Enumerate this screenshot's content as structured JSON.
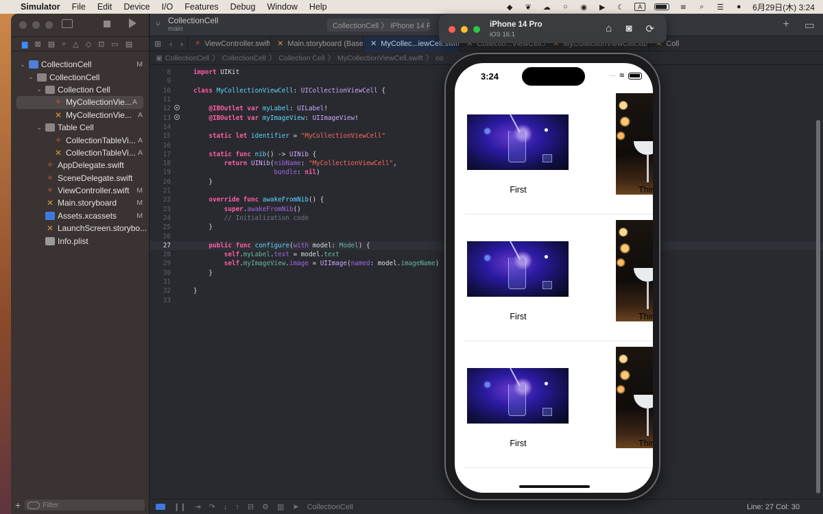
{
  "menubar": {
    "app": "Simulator",
    "items": [
      "File",
      "Edit",
      "Device",
      "I/O",
      "Features",
      "Debug",
      "Window",
      "Help"
    ],
    "input_indicator": "A",
    "datetime": "6月29日(木)  3:24"
  },
  "xcode": {
    "project_title": "CollectionCell",
    "branch": "main",
    "destination": "CollectionCell 〉 iPhone 14 P",
    "tabs": [
      "ViewController.swift",
      "Main.storyboard (Base)",
      "MyCollec...iewCell.swift",
      "Collectio...ViewCell.xib",
      "MyCollectionViewCell.xib",
      "Coll"
    ],
    "jumpbar": [
      "CollectionCell",
      "CollectionCell",
      "Collection Cell",
      "MyCollectionViewCell.swift",
      "co"
    ],
    "navigator": [
      {
        "label": "CollectionCell",
        "badge": "M",
        "level": 0,
        "icon": "project",
        "chevron": "v"
      },
      {
        "label": "CollectionCell",
        "badge": "",
        "level": 1,
        "icon": "folder",
        "chevron": "v"
      },
      {
        "label": "Collection Cell",
        "badge": "",
        "level": 2,
        "icon": "folder",
        "chevron": "v"
      },
      {
        "label": "MyCollectionVie...",
        "badge": "A",
        "level": 3,
        "icon": "swift",
        "chevron": "",
        "selected": true
      },
      {
        "label": "MyCollectionVie...",
        "badge": "A",
        "level": 3,
        "icon": "xib",
        "chevron": ""
      },
      {
        "label": "Table Cell",
        "badge": "",
        "level": 2,
        "icon": "folder",
        "chevron": "v"
      },
      {
        "label": "CollectionTableVi...",
        "badge": "A",
        "level": 3,
        "icon": "swift",
        "chevron": ""
      },
      {
        "label": "CollectionTableVi...",
        "badge": "A",
        "level": 3,
        "icon": "xib",
        "chevron": ""
      },
      {
        "label": "AppDelegate.swift",
        "badge": "",
        "level": 2,
        "icon": "swift",
        "chevron": ""
      },
      {
        "label": "SceneDelegate.swift",
        "badge": "",
        "level": 2,
        "icon": "swift",
        "chevron": ""
      },
      {
        "label": "ViewController.swift",
        "badge": "M",
        "level": 2,
        "icon": "swift",
        "chevron": ""
      },
      {
        "label": "Main.storyboard",
        "badge": "M",
        "level": 2,
        "icon": "xib",
        "chevron": ""
      },
      {
        "label": "Assets.xcassets",
        "badge": "M",
        "level": 2,
        "icon": "asset",
        "chevron": ""
      },
      {
        "label": "LaunchScreen.storybo...",
        "badge": "",
        "level": 2,
        "icon": "xib",
        "chevron": ""
      },
      {
        "label": "Info.plist",
        "badge": "",
        "level": 2,
        "icon": "plist",
        "chevron": ""
      }
    ],
    "filter_placeholder": "Filter",
    "status": {
      "scheme": "CollectionCell",
      "position": "Line: 27  Col: 30"
    },
    "code": [
      {
        "n": "8",
        "html": "<span class=\"kw\">import</span> UIKit"
      },
      {
        "n": "9",
        "html": ""
      },
      {
        "n": "10",
        "html": "<span class=\"kw\">class</span> <span class=\"ty\">MyCollectionViewCell</span>: <span class=\"ty2\">UICollectionViewCell</span> {"
      },
      {
        "n": "11",
        "html": ""
      },
      {
        "n": "12",
        "html": "    <span class=\"kw\">@IBOutlet</span> <span class=\"kw\">var</span> <span class=\"ty\">myLabel</span>: <span class=\"ty2\">UILabel</span>!",
        "dot": true
      },
      {
        "n": "13",
        "html": "    <span class=\"kw\">@IBOutlet</span> <span class=\"kw\">var</span> <span class=\"ty\">myImageView</span>: <span class=\"ty2\">UIImageView</span>!",
        "dot": true
      },
      {
        "n": "14",
        "html": ""
      },
      {
        "n": "15",
        "html": "    <span class=\"kw\">static</span> <span class=\"kw\">let</span> <span class=\"ty\">identifier</span> = <span class=\"str\">\"MyCollectionViewCell\"</span>"
      },
      {
        "n": "16",
        "html": ""
      },
      {
        "n": "17",
        "html": "    <span class=\"kw\">static</span> <span class=\"kw\">func</span> <span class=\"ty\">nib</span>() -> <span class=\"ty2\">UINib</span> {"
      },
      {
        "n": "18",
        "html": "        <span class=\"kw\">return</span> <span class=\"ty2\">UINib</span>(<span class=\"mem\">nibName</span>: <span class=\"str\">\"MyCollectionViewCell\"</span>,"
      },
      {
        "n": "19",
        "html": "                     <span class=\"mem\">bundle</span>: <span class=\"kw\">nil</span>)"
      },
      {
        "n": "20",
        "html": "    }"
      },
      {
        "n": "21",
        "html": ""
      },
      {
        "n": "22",
        "html": "    <span class=\"kw\">override</span> <span class=\"kw\">func</span> <span class=\"ty\">awakeFromNib</span>() {"
      },
      {
        "n": "23",
        "html": "        <span class=\"kw\">super</span>.<span class=\"mem\">awakeFromNib</span>()"
      },
      {
        "n": "24",
        "html": "        <span class=\"cm\">// Initialization code</span>"
      },
      {
        "n": "25",
        "html": "    }"
      },
      {
        "n": "26",
        "html": ""
      },
      {
        "n": "27",
        "html": "    <span class=\"kw\">public</span> <span class=\"kw\">func</span> <span class=\"ty\">configure</span>(<span class=\"mem\">with</span> model: <span class=\"fn\">Model</span>) {",
        "current": true
      },
      {
        "n": "28",
        "html": "        <span class=\"kw\">self</span>.<span class=\"fn\">myLabel</span>.<span class=\"mem\">text</span> = model.<span class=\"fn\">text</span>"
      },
      {
        "n": "29",
        "html": "        <span class=\"kw\">self</span>.<span class=\"fn\">myImageView</span>.<span class=\"mem\">image</span> = <span class=\"ty2\">UIImage</span>(<span class=\"mem\">named</span>: model.<span class=\"fn\">imageName</span>)"
      },
      {
        "n": "30",
        "html": "    }"
      },
      {
        "n": "31",
        "html": ""
      },
      {
        "n": "32",
        "html": "}"
      },
      {
        "n": "33",
        "html": ""
      }
    ]
  },
  "simulator": {
    "device": "iPhone 14 Pro",
    "os": "iOS 16.1",
    "time": "3:24",
    "cells": [
      {
        "left_label": "First",
        "right_label": "Thir"
      },
      {
        "left_label": "First",
        "right_label": "Thir"
      },
      {
        "left_label": "First",
        "right_label": "Thir"
      }
    ]
  }
}
